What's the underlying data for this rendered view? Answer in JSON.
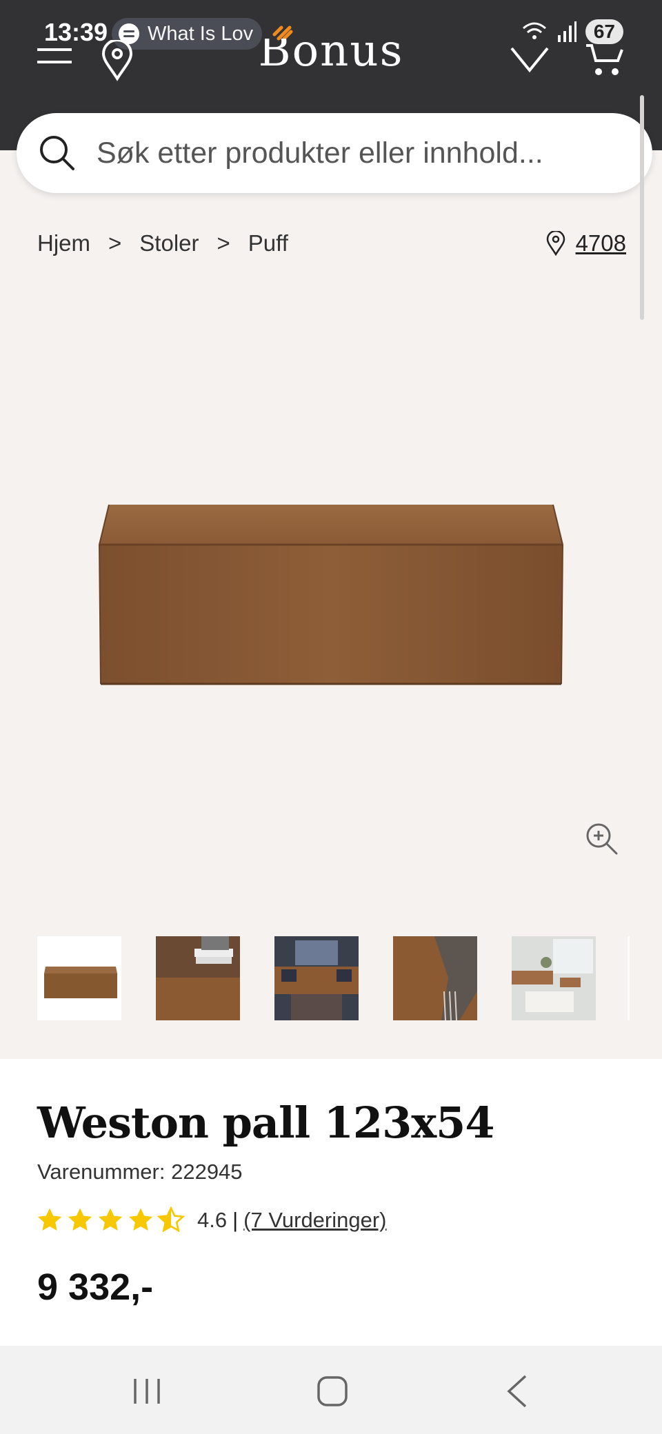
{
  "status_bar": {
    "time": "13:39",
    "media_title": "What Is Lov",
    "battery": "67"
  },
  "header": {
    "logo": "Bonus",
    "menu_icon": "hamburger-menu-icon",
    "location_icon": "map-pin-icon",
    "wishlist_icon": "heart-icon",
    "cart_icon": "cart-icon"
  },
  "search": {
    "placeholder": "Søk etter produkter eller innhold..."
  },
  "breadcrumb": {
    "items": [
      "Hjem",
      "Stoler",
      "Puff"
    ],
    "separator": ">"
  },
  "store": {
    "number": "4708"
  },
  "gallery": {
    "main_image": "brown-leather-ottoman",
    "zoom_icon": "zoom-in-icon",
    "thumbnails": [
      "ottoman-product",
      "ottoman-with-books",
      "living-room-sofa",
      "ottoman-with-throw",
      "bright-living-room"
    ]
  },
  "product": {
    "title": "Weston pall 123x54",
    "sku": "Varenummer: 222945",
    "rating": 4.6,
    "rating_label": "4.6",
    "rating_separator": "|",
    "reviews_link": "(7 Vurderinger)",
    "price": "9 332,-"
  },
  "colors": {
    "header_bg": "#323235",
    "page_bg": "#f5f2f0",
    "star": "#f7c800",
    "leather": "#8b5a33"
  }
}
